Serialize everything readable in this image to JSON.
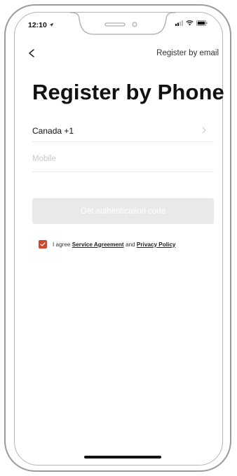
{
  "status_bar": {
    "time": "12:10"
  },
  "nav": {
    "register_by_email": "Register by email"
  },
  "title": "Register by Phone",
  "country": {
    "label": "Canada +1"
  },
  "mobile": {
    "placeholder": "Mobile",
    "value": ""
  },
  "auth_button": {
    "label": "Get authentication code"
  },
  "agreement": {
    "prefix": "I agree",
    "service": "Service Agreement",
    "and": "and",
    "privacy": "Privacy Policy",
    "checked": true
  },
  "colors": {
    "accent": "#d0472b",
    "disabled_button": "#e9e9e9"
  },
  "icons": [
    "back-chevron-icon",
    "chevron-right-icon",
    "signal-icon",
    "wifi-icon",
    "battery-icon",
    "location-arrow-icon",
    "checkmark-icon"
  ]
}
